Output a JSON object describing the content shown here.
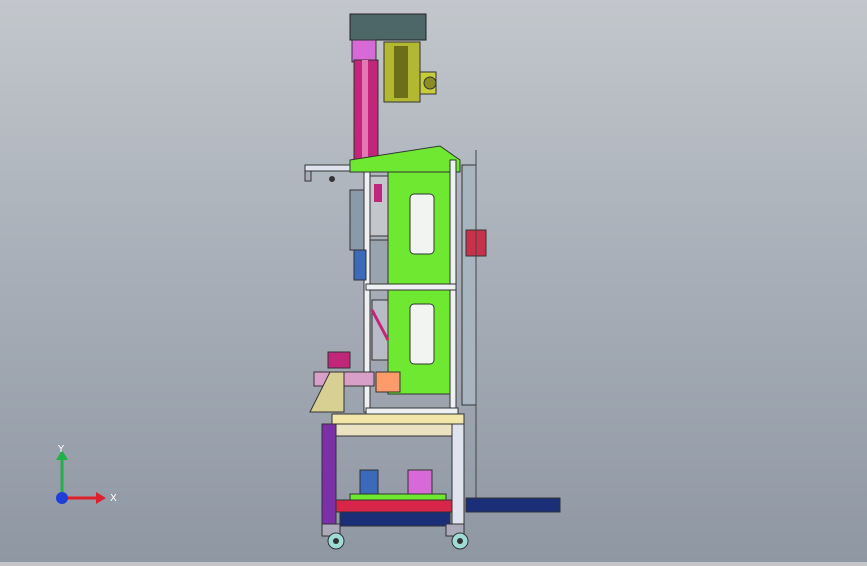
{
  "viewport": {
    "background_top": "#c3c7cc",
    "background_bottom": "#8f97a3"
  },
  "triad": {
    "y_label": "Y",
    "x_label": "X",
    "colors": {
      "x": "#e0202a",
      "y": "#22b04a",
      "z": "#1f3fd8"
    }
  },
  "model": {
    "icons": [
      "machine-assembly",
      "motor",
      "caster-wheel",
      "linear-rail"
    ],
    "colors": {
      "frame_green": "#6fe832",
      "column_magenta": "#c2267a",
      "motor_olive": "#b3b832",
      "base_red": "#d8254a",
      "base_navy": "#1b2e78",
      "leg_purple": "#7b2fa8",
      "table_yellow": "#f2e6a8"
    }
  }
}
